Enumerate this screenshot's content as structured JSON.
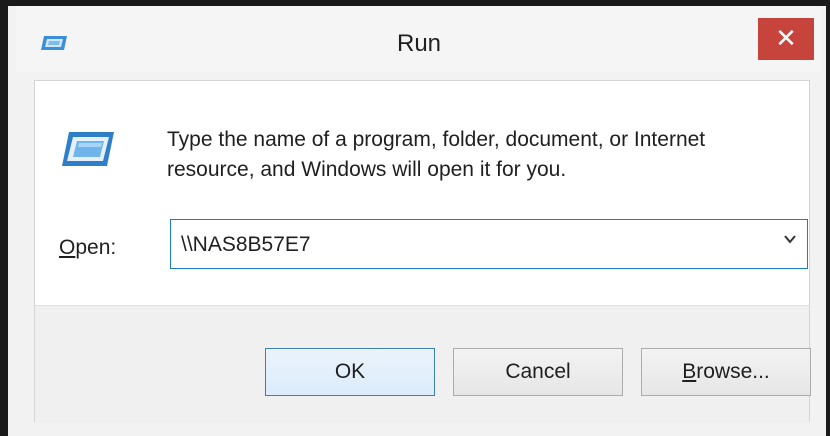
{
  "window": {
    "title": "Run",
    "close_symbol": "✕"
  },
  "dialog": {
    "description_line1": "Type the name of a program, folder, document, or Internet",
    "description_line2": "resource, and Windows will open it for you.",
    "open_label_first": "O",
    "open_label_rest": "pen:",
    "open_value": "\\\\NAS8B57E7",
    "dropdown_arrow": "⌄"
  },
  "buttons": {
    "ok": "OK",
    "cancel": "Cancel",
    "browse_first": "B",
    "browse_rest": "rowse..."
  },
  "colors": {
    "close_bg": "#c7443c",
    "focus_border": "#1e7bd2",
    "default_button_border": "#3c7fb1"
  },
  "icons": {
    "title_icon": "run-icon",
    "dialog_icon": "run-icon",
    "close_icon": "close-icon",
    "dropdown_icon": "chevron-down-icon"
  }
}
